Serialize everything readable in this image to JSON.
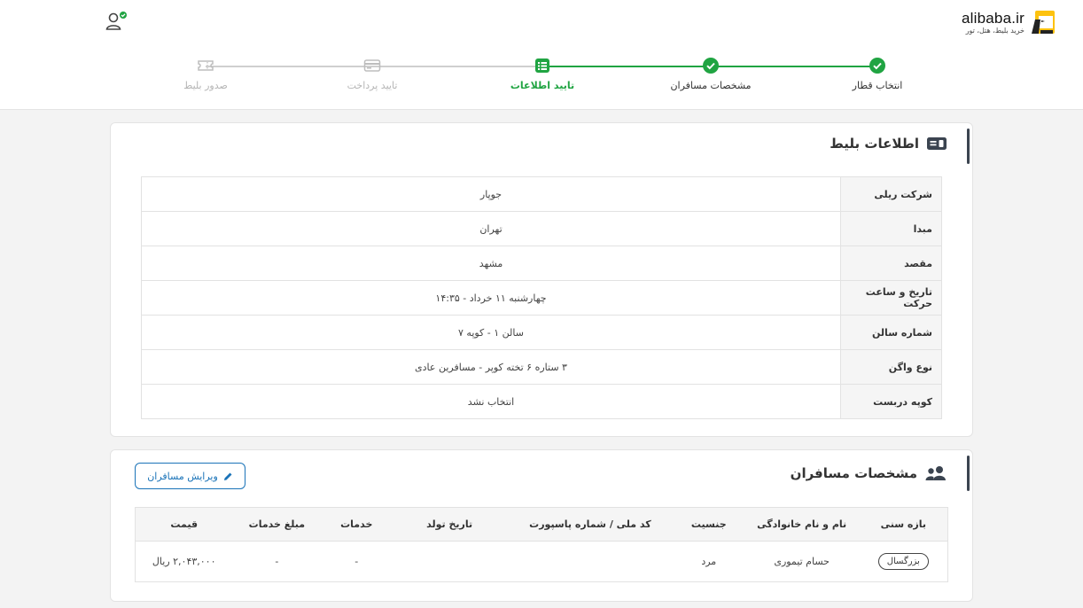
{
  "header": {
    "logo_text": "alibaba.ir",
    "logo_tagline": "خرید بلیط، هتل، تور"
  },
  "steps": [
    {
      "label": "انتخاب قطار",
      "state": "done"
    },
    {
      "label": "مشخصات مسافران",
      "state": "done"
    },
    {
      "label": "تایید اطلاعات",
      "state": "active"
    },
    {
      "label": "تایید پرداخت",
      "state": "pending"
    },
    {
      "label": "صدور بلیط",
      "state": "pending"
    }
  ],
  "ticket": {
    "title": "اطلاعات بلیط",
    "rows": [
      {
        "key": "شرکت ریلی",
        "value": "جوپار"
      },
      {
        "key": "مبدا",
        "value": "تهران"
      },
      {
        "key": "مقصد",
        "value": "مشهد"
      },
      {
        "key": "تاریخ و ساعت حرکت",
        "value": "چهارشنبه ۱۱ خرداد - ۱۴:۳۵"
      },
      {
        "key": "شماره سالن",
        "value": "سالن ۱ - کوپه ۷"
      },
      {
        "key": "نوع واگن",
        "value": "۳ ستاره ۶ تخته کوپر - مسافرین عادی"
      },
      {
        "key": "کوپه دربست",
        "value": "انتخاب نشد"
      }
    ]
  },
  "passengers": {
    "title": "مشخصات مسافران",
    "edit_label": "ویرایش مسافران",
    "columns": [
      "بازه سنی",
      "نام و نام خانوادگی",
      "جنسیت",
      "کد ملی / شماره پاسپورت",
      "تاریخ تولد",
      "خدمات",
      "مبلغ خدمات",
      "قیمت"
    ],
    "rows": [
      {
        "age": "بزرگسال",
        "name": "حسام تیموری",
        "gender": "مرد",
        "id": "",
        "birth": "",
        "services": "-",
        "service_fee": "-",
        "price": "۲,۰۴۳,۰۰۰ ریال"
      }
    ]
  },
  "colors": {
    "accent_green": "#20a442",
    "link_blue": "#1a73b8",
    "pending_gray": "#bdbdbd"
  }
}
